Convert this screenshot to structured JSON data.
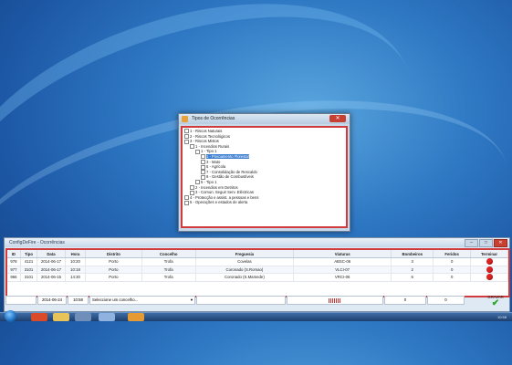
{
  "dialog": {
    "title": "Tipos de Ocorrências",
    "close_label": "✕",
    "tree": [
      {
        "label": "1 - Riscos Naturais",
        "level": 0
      },
      {
        "label": "2 - Riscos Tecnológicos",
        "level": 0
      },
      {
        "label": "3 - Riscos Mistos",
        "level": 0
      },
      {
        "label": "1 - Incendios Rurais",
        "level": 1
      },
      {
        "label": "1 - Tipo 1",
        "level": 2
      },
      {
        "label": "1 - Povoamento Florestal",
        "level": 3,
        "selected": true
      },
      {
        "label": "3 - Mato",
        "level": 3
      },
      {
        "label": "5 - Agrícola",
        "level": 3
      },
      {
        "label": "7 - Consolidação de Rescaldo",
        "level": 3
      },
      {
        "label": "9 - Gestão de Combustíveis",
        "level": 3
      },
      {
        "label": "5 - Tipo 1",
        "level": 2
      },
      {
        "label": "2 - Incendios em Detritos",
        "level": 1
      },
      {
        "label": "3 - Comun. Seguir Serv. Eléctricas",
        "level": 1
      },
      {
        "label": "4 - Protecção e assist. a pessoas e bens",
        "level": 0
      },
      {
        "label": "5 - Operações e estados de alerta",
        "level": 0
      }
    ]
  },
  "window": {
    "title": "ConfigDeFire - Ocorrências",
    "buttons": [
      "–",
      "□",
      "✕"
    ]
  },
  "table": {
    "columns": [
      "ID",
      "Tipo",
      "Data",
      "Hora",
      "Distrito",
      "Concelho",
      "Freguesia",
      "Viaturas",
      "Bombeiros",
      "Feridos",
      "Terminar"
    ],
    "rows": [
      [
        "978",
        "4121",
        "2014-06-17",
        "10:20",
        "Porto",
        "Trofa",
        "Covelas",
        "ABSC-06",
        "3",
        "0"
      ],
      [
        "977",
        "3101",
        "2014-06-17",
        "10:18",
        "Porto",
        "Trofa",
        "Coronado (S.Romao)",
        "VLCI-07",
        "2",
        "0"
      ],
      [
        "966",
        "3101",
        "2014-06-15",
        "14:30",
        "Porto",
        "Trofa",
        "Coronado (S.Mamede)",
        "VRCI-06",
        "6",
        "0"
      ]
    ],
    "new_row": {
      "date": "2014-06-24",
      "time": "10:58",
      "combo": "Seleccione um concelho...",
      "bombeiros": "0",
      "feridos": "0"
    },
    "save_label": "GRAVAR"
  },
  "colors": {
    "accent": "#d23b3b",
    "terminate": "#e02121",
    "save": "#2aa52a"
  },
  "taskbar": {
    "clock": "10:58"
  }
}
